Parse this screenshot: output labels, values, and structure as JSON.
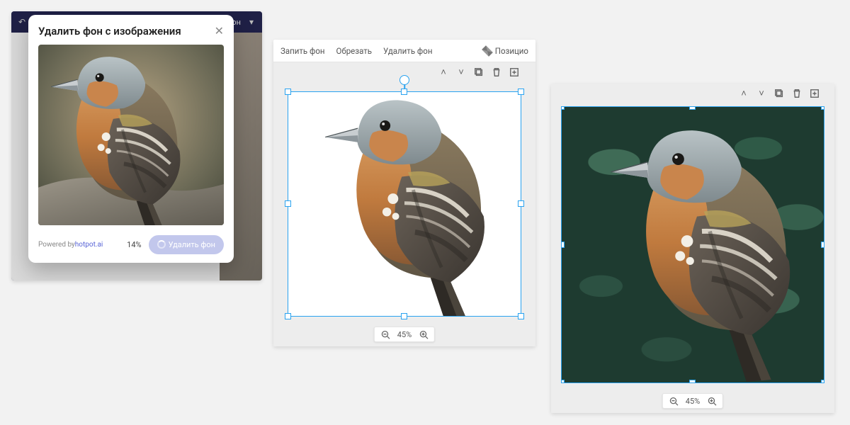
{
  "modal": {
    "title": "Удалить фон с изображения",
    "powered_by_prefix": "Powered by ",
    "powered_by_link": "hotpot.ai",
    "progress_pct": "14%",
    "button_label": "Удалить фон"
  },
  "panel1_toolbar": {
    "right_text": "рон"
  },
  "editor": {
    "menu": {
      "fill_bg": "Запить фон",
      "crop": "Обрезать",
      "remove_bg": "Удалить фон",
      "position": "Позицио"
    },
    "zoom": {
      "value": "45%"
    }
  }
}
